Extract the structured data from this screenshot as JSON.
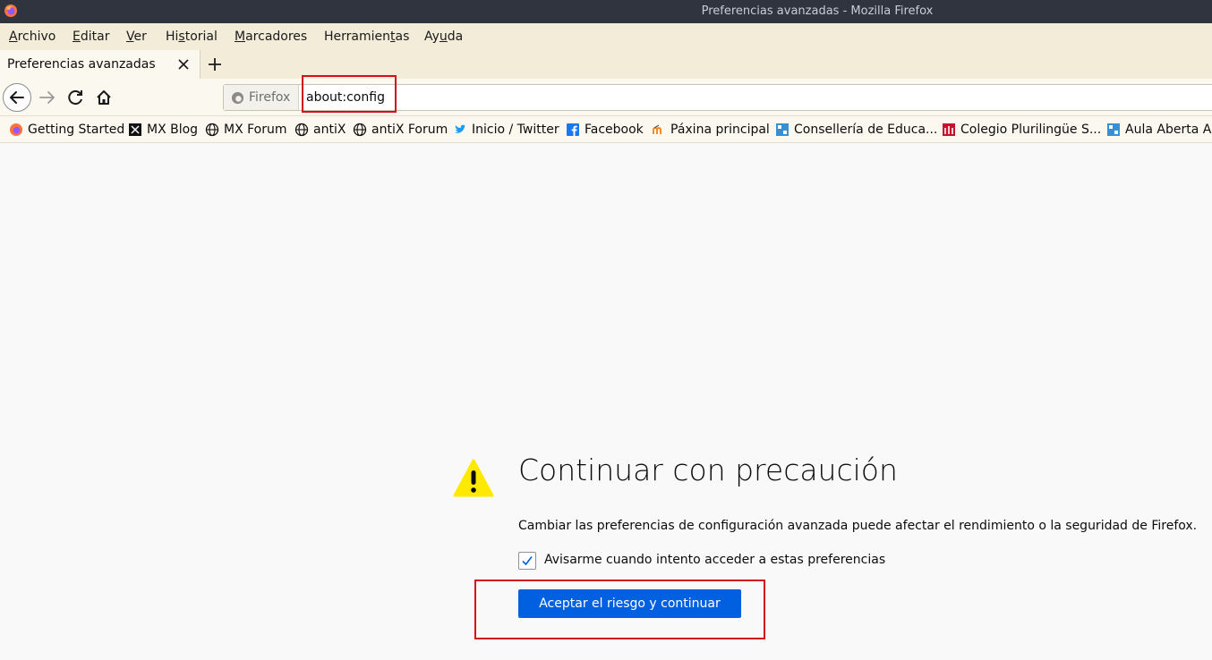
{
  "window": {
    "title": "Preferencias avanzadas - Mozilla Firefox"
  },
  "menu": [
    {
      "label": "Archivo",
      "ul": "A",
      "rest": "rchivo"
    },
    {
      "label": "Editar",
      "ul": "E",
      "rest": "ditar"
    },
    {
      "label": "Ver",
      "ul": "V",
      "rest": "er"
    },
    {
      "label": "Historial",
      "pre": "Hi",
      "ul": "s",
      "rest": "torial"
    },
    {
      "label": "Marcadores",
      "ul": "M",
      "rest": "arcadores"
    },
    {
      "label": "Herramientas",
      "pre": "Herramien",
      "ul": "t",
      "rest": "as"
    },
    {
      "label": "Ayuda",
      "pre": "Ay",
      "ul": "u",
      "rest": "da"
    }
  ],
  "tab": {
    "label": "Preferencias avanzadas"
  },
  "urlbar": {
    "identity": "Firefox",
    "url": "about:config"
  },
  "bookmarks": [
    {
      "label": "Getting Started",
      "icon": "firefox-icon"
    },
    {
      "label": "MX Blog",
      "icon": "mx-icon"
    },
    {
      "label": "MX Forum",
      "icon": "globe-icon"
    },
    {
      "label": "antiX",
      "icon": "globe-icon"
    },
    {
      "label": "antiX Forum",
      "icon": "globe-icon"
    },
    {
      "label": "Inicio / Twitter",
      "icon": "twitter-icon"
    },
    {
      "label": "Facebook",
      "icon": "facebook-icon"
    },
    {
      "label": "Páxina principal",
      "icon": "moodle-icon"
    },
    {
      "label": "Consellería de Educa...",
      "icon": "xunta-icon"
    },
    {
      "label": "Colegio Plurilingüe S...",
      "icon": "school-icon"
    },
    {
      "label": "Aula Aberta Ab",
      "icon": "xunta-icon"
    }
  ],
  "warning": {
    "heading": "Continuar con precaución",
    "description": "Cambiar las preferencias de configuración avanzada puede afectar el rendimiento o la seguridad de Firefox.",
    "checkbox_label": "Avisarme cuando intento acceder a estas preferencias",
    "checkbox_checked": true,
    "button_label": "Aceptar el riesgo y continuar"
  },
  "colors": {
    "accent": "#0060df",
    "highlight": "#d30f19",
    "warning": "#ffe900"
  }
}
